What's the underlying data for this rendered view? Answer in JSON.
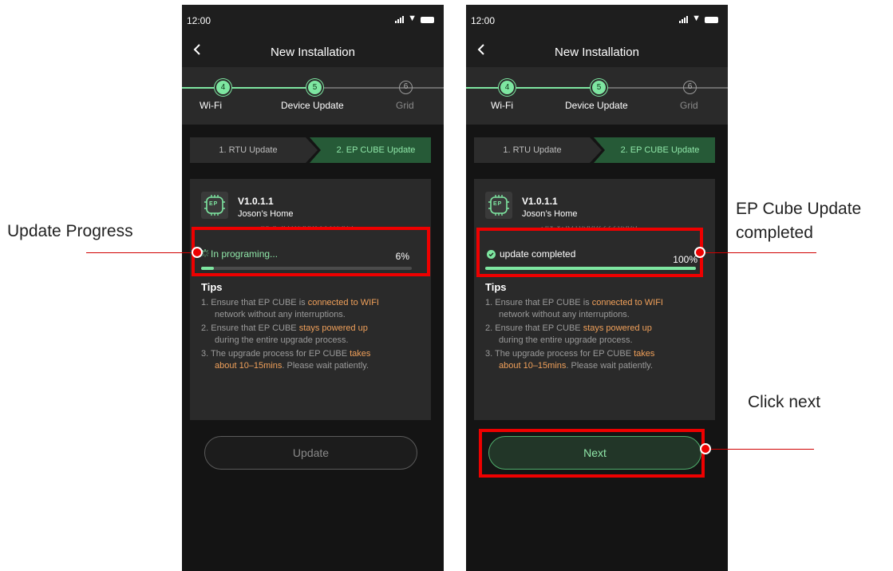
{
  "annotations": {
    "left": "Update Progress",
    "right_line1": "EP Cube Update",
    "right_line2": "completed",
    "next": "Click next"
  },
  "colors": {
    "accent_green": "#7ee6a1",
    "highlight_orange": "#f0a05a",
    "annotation_red": "#ee0000"
  },
  "screens": [
    {
      "status_time": "12:00",
      "title": "New Installation",
      "steps": [
        {
          "number": "4",
          "label": "Wi-Fi",
          "state": "done"
        },
        {
          "number": "5",
          "label": "Device Update",
          "state": "current"
        },
        {
          "number": "6",
          "label": "Grid",
          "state": "todo"
        }
      ],
      "tabs": [
        "1. RTU Update",
        "2. EP CUBE Update"
      ],
      "device": {
        "version": "V1.0.1.1",
        "name": "Joson’s Home",
        "serial": "SN:VSU1630022220303",
        "icon_text": "EP"
      },
      "progress": {
        "status": "In programing...",
        "percent_text": "6%",
        "value": 0.06,
        "icon": "spinner-icon"
      },
      "tips_title": "Tips",
      "tips": [
        {
          "line1_pre": "1. Ensure that EP CUBE is ",
          "line1_hl": "connected to WIFI",
          "line2_pre": "network without any interruptions.",
          "line2_hl": ""
        },
        {
          "line1_pre": "2. Ensure that EP CUBE ",
          "line1_hl": "stays powered up",
          "line2_pre": "during the entire upgrade process.",
          "line2_hl": ""
        },
        {
          "line1_pre": "3. The upgrade process for EP CUBE ",
          "line1_hl": "takes",
          "line2_pre": ". Please wait patiently.",
          "line2_hl": "about 10–15mins"
        }
      ],
      "button_label": "Update"
    },
    {
      "status_time": "12:00",
      "title": "New Installation",
      "steps": [
        {
          "number": "4",
          "label": "Wi-Fi",
          "state": "done"
        },
        {
          "number": "5",
          "label": "Device Update",
          "state": "current"
        },
        {
          "number": "6",
          "label": "Grid",
          "state": "todo"
        }
      ],
      "tabs": [
        "1. RTU Update",
        "2. EP CUBE Update"
      ],
      "device": {
        "version": "V1.0.1.1",
        "name": "Joson’s Home",
        "serial": "SN:VSU1630022220303",
        "icon_text": "EP"
      },
      "progress": {
        "status": "update completed",
        "percent_text": "100%",
        "value": 1.0,
        "icon": "check-circle-icon"
      },
      "tips_title": "Tips",
      "tips": [
        {
          "line1_pre": "1. Ensure that EP CUBE is ",
          "line1_hl": "connected to WIFI",
          "line2_pre": "network without any interruptions.",
          "line2_hl": ""
        },
        {
          "line1_pre": "2. Ensure that EP CUBE ",
          "line1_hl": "stays powered up",
          "line2_pre": "during the entire upgrade process.",
          "line2_hl": ""
        },
        {
          "line1_pre": "3. The upgrade process for EP CUBE ",
          "line1_hl": "takes",
          "line2_pre": ". Please wait patiently.",
          "line2_hl": "about 10–15mins"
        }
      ],
      "button_label": "Next"
    }
  ]
}
